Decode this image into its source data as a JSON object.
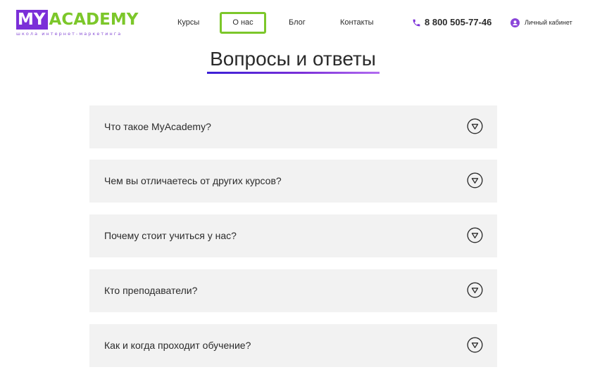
{
  "header": {
    "logo": {
      "my": "MY",
      "academy": "ACADEMY",
      "tagline": "школа интернет-маркетинга"
    },
    "nav": [
      {
        "label": "Курсы",
        "active": false
      },
      {
        "label": "О нас",
        "active": true
      },
      {
        "label": "Блог",
        "active": false
      },
      {
        "label": "Контакты",
        "active": false
      }
    ],
    "phone": {
      "icon": "phone-icon",
      "number": "8 800 505-77-46"
    },
    "account": {
      "icon": "user-icon",
      "label": "Личный кабинет"
    }
  },
  "main": {
    "title": "Вопросы и ответы",
    "faq": [
      {
        "question": "Что такое MyAcademy?",
        "icon": "chevron-down-circle-icon"
      },
      {
        "question": "Чем вы отличаетесь от других курсов?",
        "icon": "chevron-down-circle-icon"
      },
      {
        "question": "Почему стоит учиться у нас?",
        "icon": "chevron-down-circle-icon"
      },
      {
        "question": "Кто преподаватели?",
        "icon": "chevron-down-circle-icon"
      },
      {
        "question": "Как и когда проходит обучение?",
        "icon": "chevron-down-circle-icon"
      }
    ]
  },
  "colors": {
    "brand_purple": "#7b2fd8",
    "brand_green": "#7cc72a",
    "faq_background": "#f2f2f2",
    "text": "#2b2b2b"
  }
}
